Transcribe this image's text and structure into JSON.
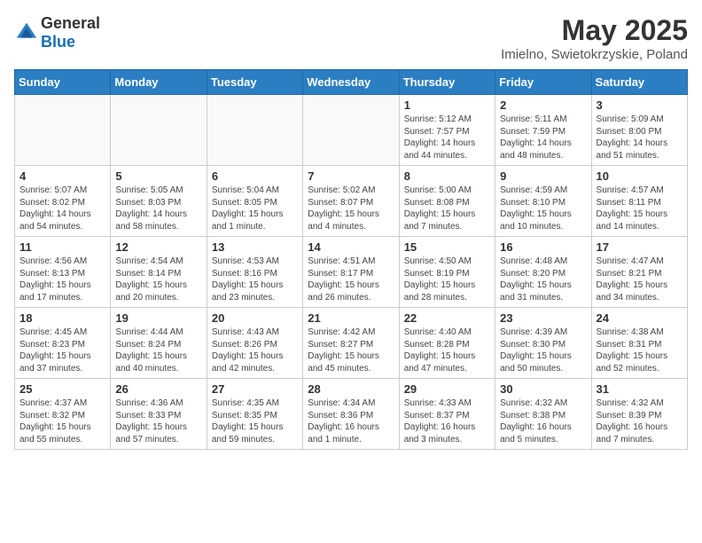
{
  "header": {
    "logo_general": "General",
    "logo_blue": "Blue",
    "month_title": "May 2025",
    "location": "Imielno, Swietokrzyskie, Poland"
  },
  "days_of_week": [
    "Sunday",
    "Monday",
    "Tuesday",
    "Wednesday",
    "Thursday",
    "Friday",
    "Saturday"
  ],
  "weeks": [
    [
      {
        "day": "",
        "info": ""
      },
      {
        "day": "",
        "info": ""
      },
      {
        "day": "",
        "info": ""
      },
      {
        "day": "",
        "info": ""
      },
      {
        "day": "1",
        "info": "Sunrise: 5:12 AM\nSunset: 7:57 PM\nDaylight: 14 hours and 44 minutes."
      },
      {
        "day": "2",
        "info": "Sunrise: 5:11 AM\nSunset: 7:59 PM\nDaylight: 14 hours and 48 minutes."
      },
      {
        "day": "3",
        "info": "Sunrise: 5:09 AM\nSunset: 8:00 PM\nDaylight: 14 hours and 51 minutes."
      }
    ],
    [
      {
        "day": "4",
        "info": "Sunrise: 5:07 AM\nSunset: 8:02 PM\nDaylight: 14 hours and 54 minutes."
      },
      {
        "day": "5",
        "info": "Sunrise: 5:05 AM\nSunset: 8:03 PM\nDaylight: 14 hours and 58 minutes."
      },
      {
        "day": "6",
        "info": "Sunrise: 5:04 AM\nSunset: 8:05 PM\nDaylight: 15 hours and 1 minute."
      },
      {
        "day": "7",
        "info": "Sunrise: 5:02 AM\nSunset: 8:07 PM\nDaylight: 15 hours and 4 minutes."
      },
      {
        "day": "8",
        "info": "Sunrise: 5:00 AM\nSunset: 8:08 PM\nDaylight: 15 hours and 7 minutes."
      },
      {
        "day": "9",
        "info": "Sunrise: 4:59 AM\nSunset: 8:10 PM\nDaylight: 15 hours and 10 minutes."
      },
      {
        "day": "10",
        "info": "Sunrise: 4:57 AM\nSunset: 8:11 PM\nDaylight: 15 hours and 14 minutes."
      }
    ],
    [
      {
        "day": "11",
        "info": "Sunrise: 4:56 AM\nSunset: 8:13 PM\nDaylight: 15 hours and 17 minutes."
      },
      {
        "day": "12",
        "info": "Sunrise: 4:54 AM\nSunset: 8:14 PM\nDaylight: 15 hours and 20 minutes."
      },
      {
        "day": "13",
        "info": "Sunrise: 4:53 AM\nSunset: 8:16 PM\nDaylight: 15 hours and 23 minutes."
      },
      {
        "day": "14",
        "info": "Sunrise: 4:51 AM\nSunset: 8:17 PM\nDaylight: 15 hours and 26 minutes."
      },
      {
        "day": "15",
        "info": "Sunrise: 4:50 AM\nSunset: 8:19 PM\nDaylight: 15 hours and 28 minutes."
      },
      {
        "day": "16",
        "info": "Sunrise: 4:48 AM\nSunset: 8:20 PM\nDaylight: 15 hours and 31 minutes."
      },
      {
        "day": "17",
        "info": "Sunrise: 4:47 AM\nSunset: 8:21 PM\nDaylight: 15 hours and 34 minutes."
      }
    ],
    [
      {
        "day": "18",
        "info": "Sunrise: 4:45 AM\nSunset: 8:23 PM\nDaylight: 15 hours and 37 minutes."
      },
      {
        "day": "19",
        "info": "Sunrise: 4:44 AM\nSunset: 8:24 PM\nDaylight: 15 hours and 40 minutes."
      },
      {
        "day": "20",
        "info": "Sunrise: 4:43 AM\nSunset: 8:26 PM\nDaylight: 15 hours and 42 minutes."
      },
      {
        "day": "21",
        "info": "Sunrise: 4:42 AM\nSunset: 8:27 PM\nDaylight: 15 hours and 45 minutes."
      },
      {
        "day": "22",
        "info": "Sunrise: 4:40 AM\nSunset: 8:28 PM\nDaylight: 15 hours and 47 minutes."
      },
      {
        "day": "23",
        "info": "Sunrise: 4:39 AM\nSunset: 8:30 PM\nDaylight: 15 hours and 50 minutes."
      },
      {
        "day": "24",
        "info": "Sunrise: 4:38 AM\nSunset: 8:31 PM\nDaylight: 15 hours and 52 minutes."
      }
    ],
    [
      {
        "day": "25",
        "info": "Sunrise: 4:37 AM\nSunset: 8:32 PM\nDaylight: 15 hours and 55 minutes."
      },
      {
        "day": "26",
        "info": "Sunrise: 4:36 AM\nSunset: 8:33 PM\nDaylight: 15 hours and 57 minutes."
      },
      {
        "day": "27",
        "info": "Sunrise: 4:35 AM\nSunset: 8:35 PM\nDaylight: 15 hours and 59 minutes."
      },
      {
        "day": "28",
        "info": "Sunrise: 4:34 AM\nSunset: 8:36 PM\nDaylight: 16 hours and 1 minute."
      },
      {
        "day": "29",
        "info": "Sunrise: 4:33 AM\nSunset: 8:37 PM\nDaylight: 16 hours and 3 minutes."
      },
      {
        "day": "30",
        "info": "Sunrise: 4:32 AM\nSunset: 8:38 PM\nDaylight: 16 hours and 5 minutes."
      },
      {
        "day": "31",
        "info": "Sunrise: 4:32 AM\nSunset: 8:39 PM\nDaylight: 16 hours and 7 minutes."
      }
    ]
  ]
}
